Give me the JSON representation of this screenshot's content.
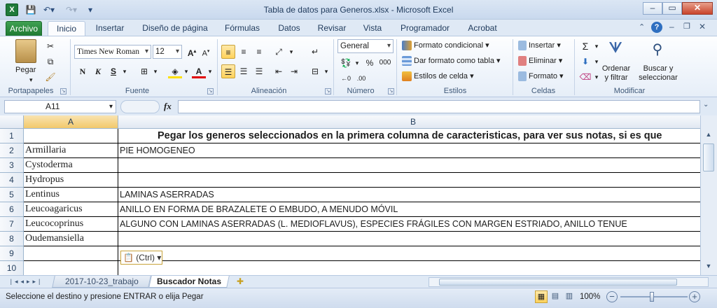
{
  "window": {
    "title": "Tabla de datos para Generos.xlsx  -  Microsoft Excel"
  },
  "qat": {
    "excel_icon": "X",
    "save_icon": "save-icon",
    "undo_icon": "undo-icon",
    "redo_icon": "redo-icon"
  },
  "tabs": [
    {
      "label": "Archivo"
    },
    {
      "label": "Inicio"
    },
    {
      "label": "Insertar"
    },
    {
      "label": "Diseño de página"
    },
    {
      "label": "Fórmulas"
    },
    {
      "label": "Datos"
    },
    {
      "label": "Revisar"
    },
    {
      "label": "Vista"
    },
    {
      "label": "Programador"
    },
    {
      "label": "Acrobat"
    }
  ],
  "ribbon": {
    "groups": [
      "Portapapeles",
      "Fuente",
      "Alineación",
      "Número",
      "Estilos",
      "Celdas",
      "Modificar"
    ],
    "paste_label": "Pegar",
    "font_name": "Times New Roman",
    "font_size": "12",
    "number_format": "General",
    "conditional_format": "Formato condicional",
    "format_as_table": "Dar formato como tabla",
    "cell_styles": "Estilos de celda",
    "insert": "Insertar",
    "delete": "Eliminar",
    "format": "Formato",
    "sort_filter": "Ordenar y filtrar",
    "find_select": "Buscar y seleccionar"
  },
  "formula_bar": {
    "name_box": "A11",
    "fx": "fx",
    "content": ""
  },
  "columns": [
    "A",
    "B"
  ],
  "rows": [
    {
      "num": "1",
      "a": "",
      "b": "Pegar los generos seleccionados en la primera columna de caracteristicas, para ver sus notas, si es que"
    },
    {
      "num": "2",
      "a": "Armillaria",
      "b": "PIE HOMOGENEO"
    },
    {
      "num": "3",
      "a": "Cystoderma",
      "b": ""
    },
    {
      "num": "4",
      "a": "Hydropus",
      "b": ""
    },
    {
      "num": "5",
      "a": "Lentinus",
      "b": "LAMINAS ASERRADAS"
    },
    {
      "num": "6",
      "a": "Leucoagaricus",
      "b": "ANILLO EN FORMA DE BRAZALETE O EMBUDO, A MENUDO MÓVIL"
    },
    {
      "num": "7",
      "a": "Leucocoprinus",
      "b": "ALGUNO CON LAMINAS ASERRADAS (L. MEDIOFLAVUS), ESPECIES FRÁGILES CON MARGEN ESTRIADO, ANILLO TENUE"
    },
    {
      "num": "8",
      "a": "Oudemansiella",
      "b": ""
    },
    {
      "num": "9",
      "a": "",
      "b": ""
    },
    {
      "num": "10",
      "a": "",
      "b": ""
    }
  ],
  "paste_options": "(Ctrl)",
  "sheets": [
    {
      "label": "2017-10-23_trabajo"
    },
    {
      "label": "Buscador Notas"
    }
  ],
  "status": {
    "message": "Seleccione el destino y presione ENTRAR o elija Pegar",
    "zoom": "100%"
  }
}
